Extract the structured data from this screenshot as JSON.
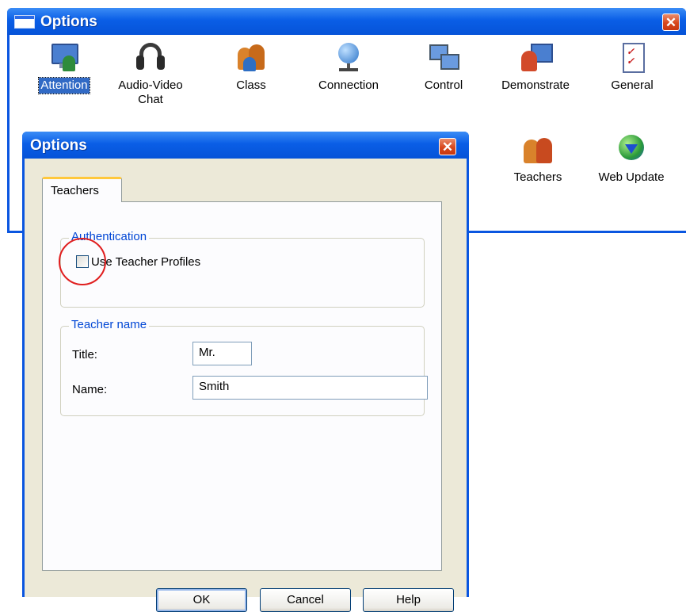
{
  "outer_window": {
    "title": "Options",
    "close_glyph": "✕",
    "toolbar": [
      {
        "label": "Attention",
        "icon": "attention-icon",
        "selected": true
      },
      {
        "label": "Audio-Video\nChat",
        "icon": "headset-icon"
      },
      {
        "label": "Class",
        "icon": "class-icon"
      },
      {
        "label": "Connection",
        "icon": "connection-icon"
      },
      {
        "label": "Control",
        "icon": "control-icon"
      },
      {
        "label": "Demonstrate",
        "icon": "demonstrate-icon"
      },
      {
        "label": "General",
        "icon": "general-icon"
      },
      {
        "label": "Teachers",
        "icon": "teachers-icon"
      },
      {
        "label": "Web Update",
        "icon": "web-update-icon"
      }
    ]
  },
  "dialog": {
    "title": "Options",
    "close_glyph": "✕",
    "tab_label": "Teachers",
    "authentication": {
      "legend": "Authentication",
      "checkbox_label": "Use Teacher Profiles",
      "checked": false
    },
    "teacher_name": {
      "legend": "Teacher name",
      "title_label": "Title:",
      "title_value": "Mr.",
      "name_label": "Name:",
      "name_value": "Smith"
    },
    "buttons": {
      "ok": "OK",
      "cancel": "Cancel",
      "help": "Help"
    }
  },
  "colors": {
    "titlebar": "#0a5ee6",
    "close_button": "#d8471d",
    "dialog_face": "#ece9d8",
    "legend_text": "#0046d5",
    "highlight_ring": "#e01e1e",
    "selected_item": "#316ac5"
  }
}
